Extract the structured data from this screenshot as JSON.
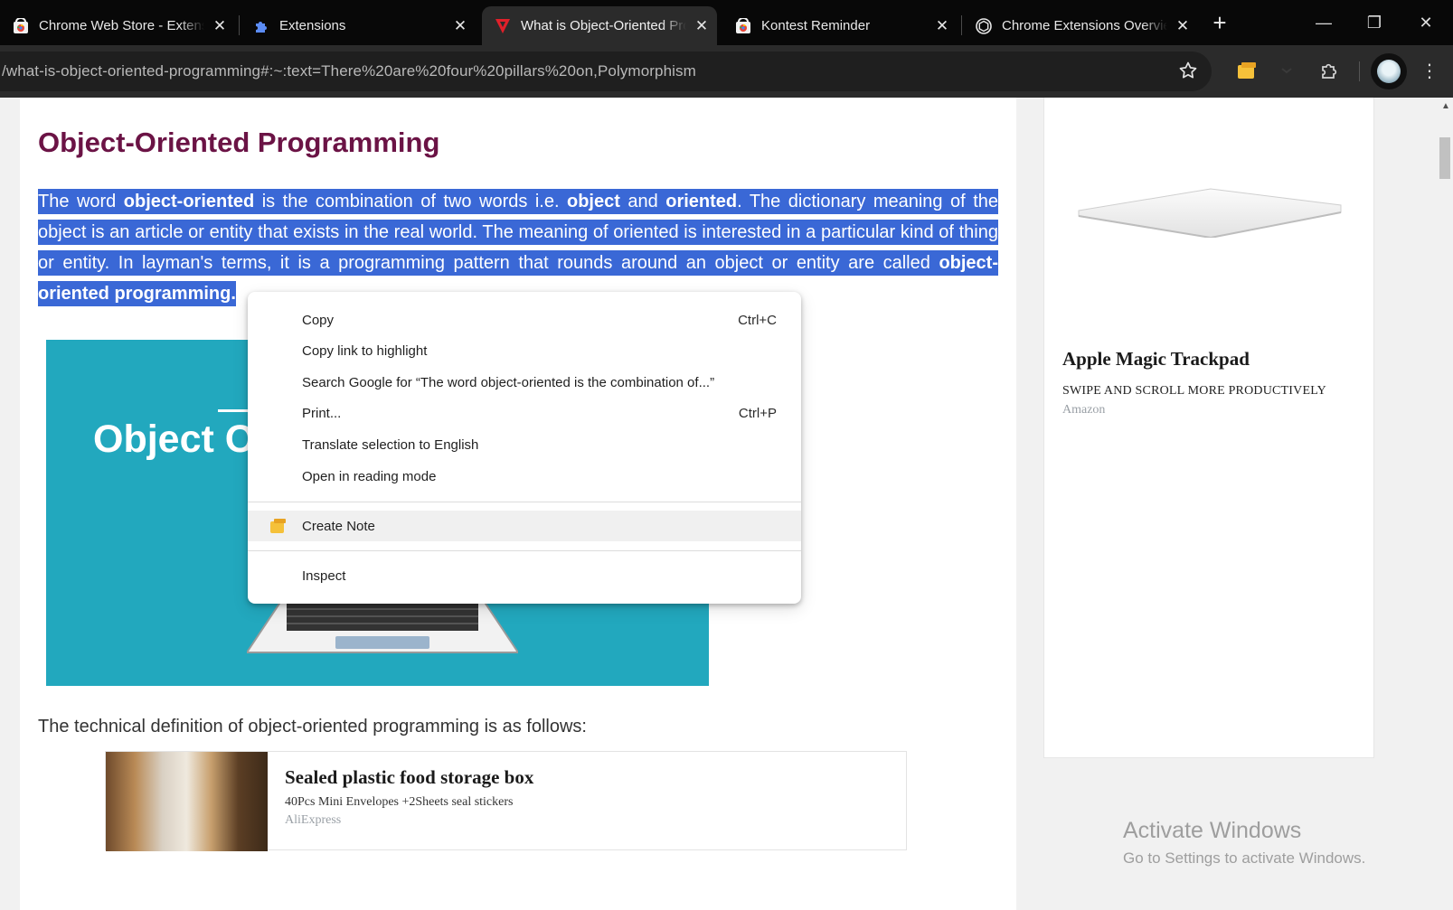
{
  "browser": {
    "tabs": [
      {
        "title": "Chrome Web Store - Extensions",
        "icon": "chrome-web-store-icon",
        "active": false
      },
      {
        "title": "Extensions",
        "icon": "puzzle-piece-icon",
        "active": false
      },
      {
        "title": "What is Object-Oriented Programming",
        "icon": "javatpoint-icon",
        "active": true
      },
      {
        "title": "Kontest Reminder",
        "icon": "chrome-web-store-icon",
        "active": false
      },
      {
        "title": "Chrome Extensions Overview",
        "icon": "openai-icon",
        "active": false
      }
    ],
    "new_tab": "+",
    "window_controls": {
      "minimize": "—",
      "restore": "❐",
      "close": "✕"
    },
    "url": "/what-is-object-oriented-programming#:~:text=There%20are%20four%20pillars%20on,Polymorphism"
  },
  "article": {
    "title": "Object-Oriented Programming",
    "para_parts": [
      {
        "text": "The word ",
        "bold": false
      },
      {
        "text": "object-oriented",
        "bold": true
      },
      {
        "text": " is the combination of two words i.e. ",
        "bold": false
      },
      {
        "text": "object",
        "bold": true
      },
      {
        "text": " and ",
        "bold": false
      },
      {
        "text": "oriented",
        "bold": true
      },
      {
        "text": ". The dictionary meaning of the object is an article or entity that exists in the real world. The meaning of oriented is interested in a particular kind of thing or entity. In layman's terms, it is a programming pattern that rounds around an object or entity are called ",
        "bold": false
      },
      {
        "text": "object-oriented programming.",
        "bold": true
      }
    ],
    "image_text": "Object O",
    "tech_def": "The technical definition of object-oriented programming is as follows:",
    "ad": {
      "title": "Sealed plastic food storage box",
      "desc": "40Pcs Mini Envelopes +2Sheets seal stickers",
      "source": "AliExpress"
    }
  },
  "sidebar_ad": {
    "title": "Apple Magic Trackpad",
    "desc": "SWIPE AND SCROLL MORE PRODUCTIVELY",
    "source": "Amazon"
  },
  "watermark": {
    "title": "Activate Windows",
    "sub": "Go to Settings to activate Windows."
  },
  "context_menu": {
    "items": [
      {
        "label": "Copy",
        "shortcut": "Ctrl+C"
      },
      {
        "label": "Copy link to highlight",
        "shortcut": ""
      },
      {
        "label": "Search Google for “The word object-oriented is the combination of...”",
        "shortcut": ""
      },
      {
        "label": "Print...",
        "shortcut": "Ctrl+P"
      },
      {
        "label": "Translate selection to English",
        "shortcut": ""
      },
      {
        "label": "Open in reading mode",
        "shortcut": ""
      },
      {
        "label": "Create Note",
        "shortcut": "",
        "icon": "sticky-note-icon"
      },
      {
        "label": "Inspect",
        "shortcut": ""
      }
    ]
  },
  "colors": {
    "selection": "#3a68d6",
    "title": "#6b1345",
    "image_bg": "#22a8be",
    "note_icon": "#f5c13a"
  }
}
